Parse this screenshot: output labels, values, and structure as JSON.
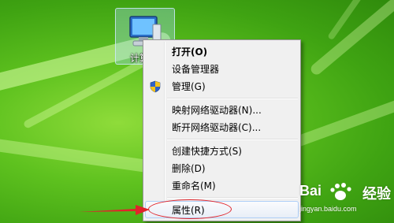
{
  "desktop_icon": {
    "label": "计算"
  },
  "context_menu": {
    "items": [
      {
        "label": "打开(O)"
      },
      {
        "label": "设备管理器"
      },
      {
        "label": "管理(G)"
      },
      {
        "label": "映射网络驱动器(N)..."
      },
      {
        "label": "断开网络驱动器(C)..."
      },
      {
        "label": "创建快捷方式(S)"
      },
      {
        "label": "删除(D)"
      },
      {
        "label": "重命名(M)"
      },
      {
        "label": "属性(R)"
      }
    ]
  },
  "annotation": {
    "color": "#e0242b"
  },
  "watermark": {
    "brand": "Bai",
    "brand2": "经验",
    "url": "jingyan.baidu.com"
  }
}
